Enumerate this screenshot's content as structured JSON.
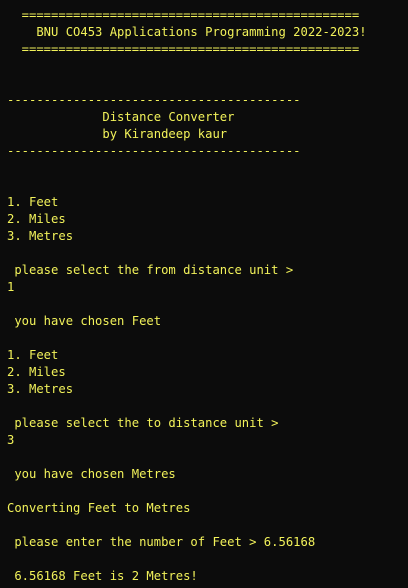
{
  "console": {
    "lines": [
      "  ==============================================",
      "    BNU CO453 Applications Programming 2022-2023!",
      "  ==============================================",
      "",
      "",
      "----------------------------------------",
      "             Distance Converter",
      "             by Kirandeep kaur",
      "----------------------------------------",
      "",
      "",
      "1. Feet",
      "2. Miles",
      "3. Metres",
      "",
      " please select the from distance unit >",
      "1",
      "",
      " you have chosen Feet",
      "",
      "1. Feet",
      "2. Miles",
      "3. Metres",
      "",
      " please select the to distance unit >",
      "3",
      "",
      " you have chosen Metres",
      "",
      "Converting Feet to Metres",
      "",
      " please enter the number of Feet > 6.56168",
      "",
      " 6.56168 Feet is 2 Metres!"
    ],
    "text_color": "#f2f25a",
    "background_color": "#0c0c0c"
  }
}
